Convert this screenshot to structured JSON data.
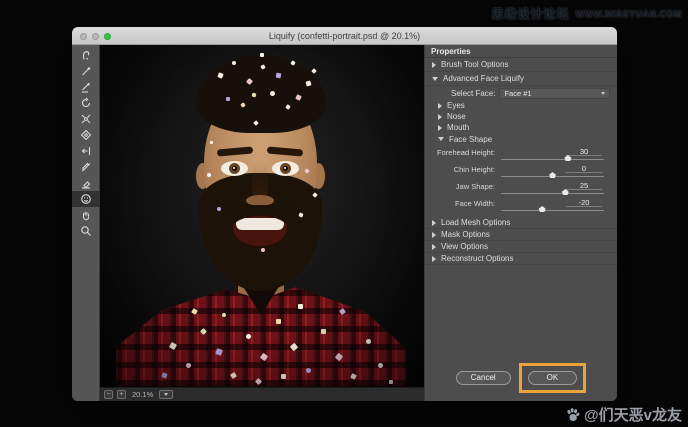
{
  "watermark_top": {
    "cn": "思缘设计论坛",
    "en": "WWW.MISSYUAN.COM"
  },
  "watermark_bottom": {
    "handle": "@们天恶v龙友",
    "icon": "baidu-paw-icon"
  },
  "dialog": {
    "title": "Liquify (confetti-portrait.psd @ 20.1%)",
    "traffic_lights": [
      "close-disabled",
      "minimize-disabled",
      "zoom-green"
    ]
  },
  "toolbar": {
    "tools": [
      {
        "name": "forward-warp-tool",
        "selected": false
      },
      {
        "name": "reconstruct-tool",
        "selected": false
      },
      {
        "name": "smooth-tool",
        "selected": false
      },
      {
        "name": "twirl-clockwise-tool",
        "selected": false
      },
      {
        "name": "pucker-tool",
        "selected": false
      },
      {
        "name": "bloat-tool",
        "selected": false
      },
      {
        "name": "push-left-tool",
        "selected": false
      },
      {
        "name": "freeze-mask-tool",
        "selected": false
      },
      {
        "name": "thaw-mask-tool",
        "selected": false
      },
      {
        "name": "face-tool",
        "selected": true
      },
      {
        "name": "hand-tool",
        "selected": false
      },
      {
        "name": "zoom-tool",
        "selected": false
      }
    ]
  },
  "statusbar": {
    "zoom_out": "−",
    "zoom_in": "+",
    "zoom_level": "20.1%"
  },
  "panel": {
    "header": "Properties",
    "brush_tool_options": {
      "label": "Brush Tool Options",
      "expanded": false
    },
    "advanced_face_liquify": {
      "label": "Advanced Face Liquify",
      "expanded": true
    },
    "select_face": {
      "label": "Select Face:",
      "value": "Face #1"
    },
    "subsections": [
      {
        "label": "Eyes",
        "expanded": false
      },
      {
        "label": "Nose",
        "expanded": false
      },
      {
        "label": "Mouth",
        "expanded": false
      },
      {
        "label": "Face Shape",
        "expanded": true
      }
    ],
    "sliders": [
      {
        "label": "Forehead Height:",
        "value": 30,
        "min": -100,
        "max": 100
      },
      {
        "label": "Chin Height:",
        "value": 0,
        "min": -100,
        "max": 100
      },
      {
        "label": "Jaw Shape:",
        "value": 25,
        "min": -100,
        "max": 100
      },
      {
        "label": "Face Width:",
        "value": -20,
        "min": -100,
        "max": 100
      }
    ],
    "bottom_sections": [
      {
        "label": "Load Mesh Options",
        "expanded": false
      },
      {
        "label": "Mask Options",
        "expanded": false
      },
      {
        "label": "View Options",
        "expanded": false
      },
      {
        "label": "Reconstruct Options",
        "expanded": false
      }
    ],
    "cancel_label": "Cancel",
    "ok_label": "OK",
    "annotation_color": "#eca33c"
  }
}
